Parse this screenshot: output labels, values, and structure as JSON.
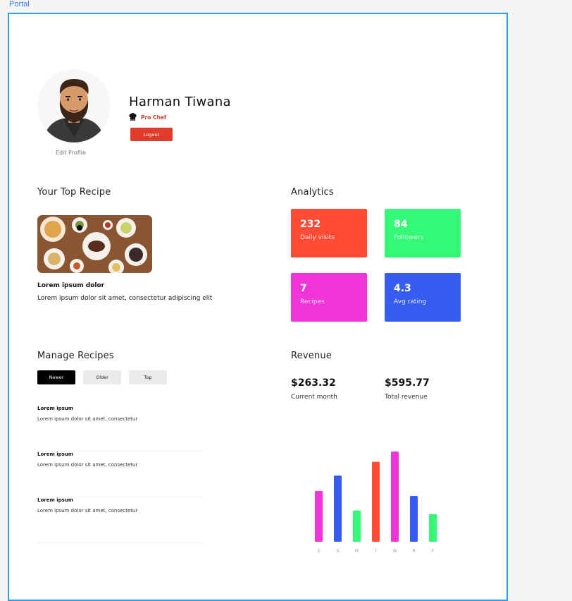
{
  "app": {
    "portal_label": "Portal"
  },
  "profile": {
    "name": "Harman Tiwana",
    "badge": "Pro Chef",
    "logout_label": "Logout",
    "edit_profile_label": "Edit Profile"
  },
  "top_recipe": {
    "section_title": "Your Top Recipe",
    "title": "Lorem ipsum dolor",
    "description": "Lorem ipsum dolor sit amet, consectetur adipiscing elit"
  },
  "analytics": {
    "section_title": "Analytics",
    "cards": [
      {
        "value": "232",
        "label": "Daily visits",
        "color": "#ff4a35"
      },
      {
        "value": "84",
        "label": "Followers",
        "color": "#33f977"
      },
      {
        "value": "7",
        "label": "Recipes",
        "color": "#f233d8"
      },
      {
        "value": "4.3",
        "label": "Avg rating",
        "color": "#365cf2"
      }
    ]
  },
  "manage": {
    "section_title": "Manage Recipes",
    "tabs": [
      "Newer",
      "Older",
      "Top"
    ],
    "items": [
      {
        "title": "Lorem ipsum",
        "desc": "Lorem ipsum dolor sit amet, consectetur"
      },
      {
        "title": "Lorem ipsum",
        "desc": "Lorem ipsum dolor sit amet, consectetur"
      },
      {
        "title": "Lorem ipsum",
        "desc": "Lorem ipsum dolor sit amet, consectetur"
      }
    ]
  },
  "revenue": {
    "section_title": "Revenue",
    "current_value": "$263.32",
    "current_label": "Current month",
    "total_value": "$595.77",
    "total_label": "Total revenue"
  },
  "chart_data": {
    "type": "bar",
    "categories": [
      "S",
      "S",
      "M",
      "T",
      "W",
      "R",
      "F"
    ],
    "values": [
      70,
      91,
      43,
      110,
      124,
      63,
      38
    ],
    "colors": [
      "#f233d8",
      "#365cf2",
      "#33f977",
      "#ff4a35",
      "#f233d8",
      "#365cf2",
      "#33f977"
    ],
    "title": "",
    "xlabel": "",
    "ylabel": "",
    "ylim": [
      0,
      130
    ],
    "grid": false
  }
}
